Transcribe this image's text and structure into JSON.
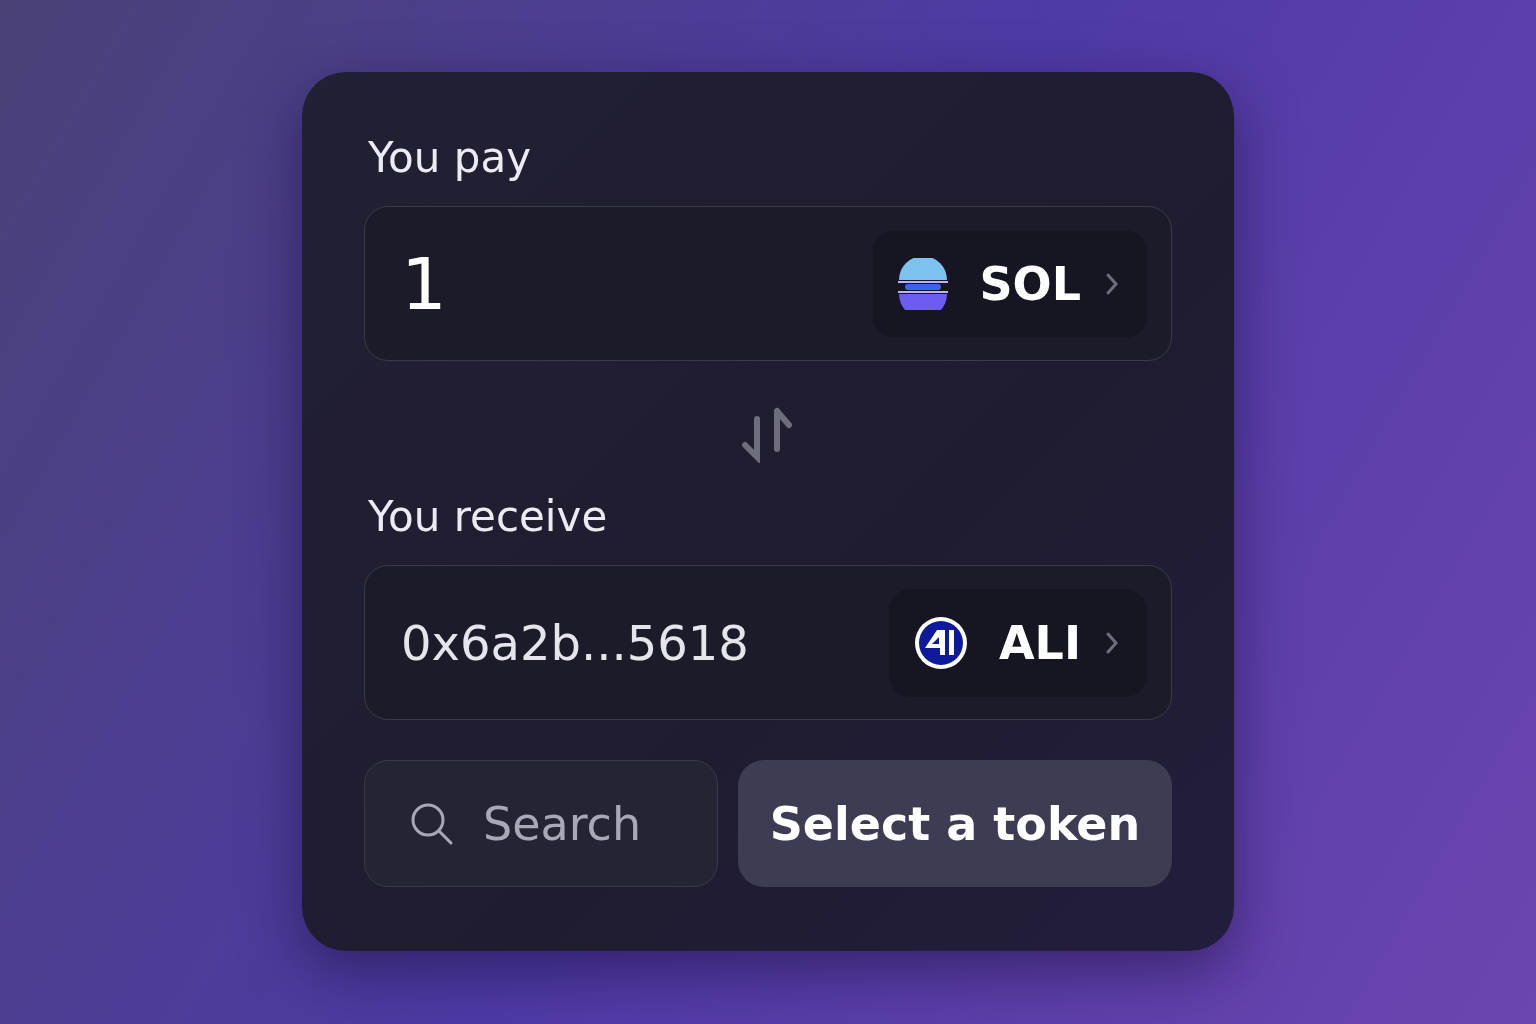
{
  "pay": {
    "label": "You pay",
    "value": "1",
    "token": {
      "symbol": "SOL",
      "kind": "sol"
    }
  },
  "receive": {
    "label": "You receive",
    "value": "0x6a2b...5618",
    "token": {
      "symbol": "ALI",
      "kind": "ali"
    }
  },
  "search": {
    "placeholder": "Search"
  },
  "button": "Select a token"
}
